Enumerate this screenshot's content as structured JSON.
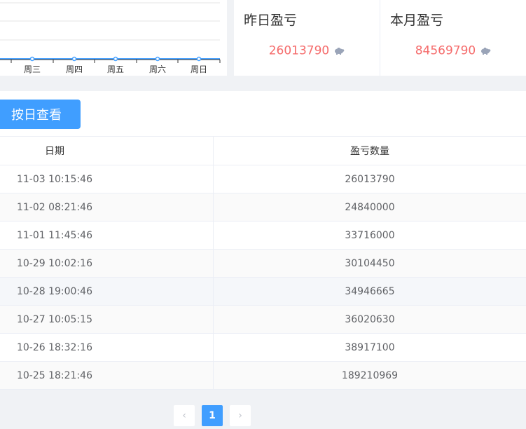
{
  "chart": {
    "x_labels": [
      "周三",
      "周四",
      "周五",
      "周六",
      "周日"
    ]
  },
  "stats": {
    "yesterday": {
      "title": "昨日盈亏",
      "value": "26013790"
    },
    "month": {
      "title": "本月盈亏",
      "value": "84569790"
    }
  },
  "toolbar": {
    "by_day_label": "按日查看"
  },
  "table": {
    "headers": {
      "date": "日期",
      "amount": "盈亏数量"
    },
    "rows": [
      {
        "date": "11-03 10:15:46",
        "amount": "26013790"
      },
      {
        "date": "11-02 08:21:46",
        "amount": "24840000"
      },
      {
        "date": "11-01 11:45:46",
        "amount": "33716000"
      },
      {
        "date": "10-29 10:02:16",
        "amount": "30104450"
      },
      {
        "date": "10-28 19:00:46",
        "amount": "34946665"
      },
      {
        "date": "10-27 10:05:15",
        "amount": "36020630"
      },
      {
        "date": "10-26 18:32:16",
        "amount": "38917100"
      },
      {
        "date": "10-25 18:21:46",
        "amount": "189210969"
      }
    ]
  },
  "pagination": {
    "prev": "‹",
    "current": "1",
    "next": "›"
  },
  "colors": {
    "accent": "#409eff",
    "negative": "#f56c6c",
    "line": "#409eff"
  }
}
